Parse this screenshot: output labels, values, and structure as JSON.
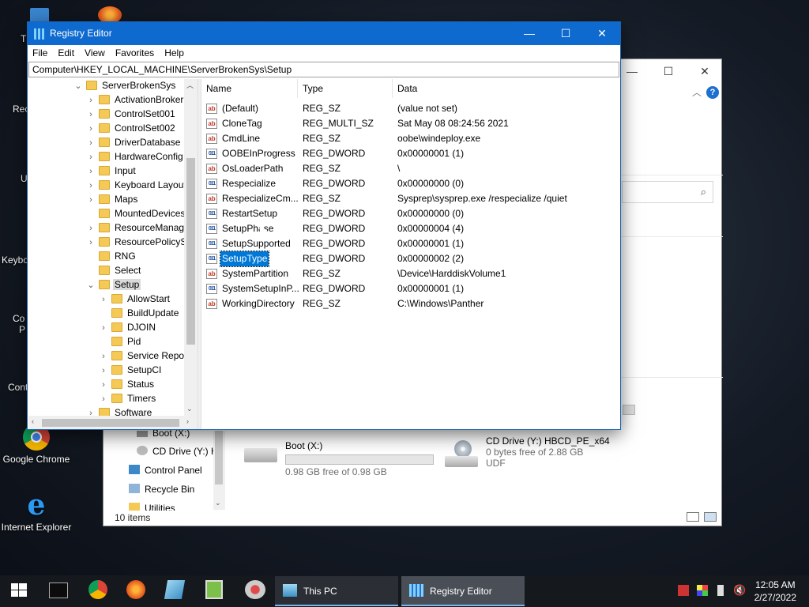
{
  "desktop": {
    "icons": [
      {
        "label": "Google Chrome"
      },
      {
        "label": "Internet Explorer"
      }
    ],
    "fragments": [
      "T",
      "Rec",
      "U",
      "Keybo",
      "Co",
      "P",
      "Cont"
    ]
  },
  "explorer": {
    "nav_items": [
      {
        "label": "Boot (X:)"
      },
      {
        "label": "CD Drive (Y:) H"
      },
      {
        "label": "Control Panel"
      },
      {
        "label": "Recycle Bin"
      },
      {
        "label": "Utilities"
      }
    ],
    "drives": [
      {
        "name": "Boot (X:)",
        "info": "0.98 GB free of 0.98 GB",
        "used_fraction": 0.0
      },
      {
        "name": "CD Drive (Y:) HBCD_PE_x64",
        "info": "0 bytes free of 2.88 GB",
        "fs": "UDF"
      }
    ],
    "status": "10 items",
    "help_glyph": "?"
  },
  "regedit": {
    "title": "Registry Editor",
    "menu": [
      "File",
      "Edit",
      "View",
      "Favorites",
      "Help"
    ],
    "address": "Computer\\HKEY_LOCAL_MACHINE\\ServerBrokenSys\\Setup",
    "tree": [
      {
        "label": "ServerBrokenSys",
        "chev": "⌄",
        "level": 0
      },
      {
        "label": "ActivationBroker",
        "chev": "›",
        "level": 1
      },
      {
        "label": "ControlSet001",
        "chev": "›",
        "level": 1
      },
      {
        "label": "ControlSet002",
        "chev": "›",
        "level": 1
      },
      {
        "label": "DriverDatabase",
        "chev": "›",
        "level": 1
      },
      {
        "label": "HardwareConfig",
        "chev": "›",
        "level": 1
      },
      {
        "label": "Input",
        "chev": "›",
        "level": 1
      },
      {
        "label": "Keyboard Layout",
        "chev": "›",
        "level": 1
      },
      {
        "label": "Maps",
        "chev": "›",
        "level": 1
      },
      {
        "label": "MountedDevices",
        "chev": "",
        "level": 1
      },
      {
        "label": "ResourceManager",
        "chev": "›",
        "level": 1
      },
      {
        "label": "ResourcePolicyStore",
        "chev": "›",
        "level": 1
      },
      {
        "label": "RNG",
        "chev": "",
        "level": 1
      },
      {
        "label": "Select",
        "chev": "",
        "level": 1
      },
      {
        "label": "Setup",
        "chev": "⌄",
        "level": 1,
        "selected": true
      },
      {
        "label": "AllowStart",
        "chev": "›",
        "level": 2
      },
      {
        "label": "BuildUpdate",
        "chev": "",
        "level": 2
      },
      {
        "label": "DJOIN",
        "chev": "›",
        "level": 2
      },
      {
        "label": "Pid",
        "chev": "",
        "level": 2
      },
      {
        "label": "Service Reporting",
        "chev": "›",
        "level": 2
      },
      {
        "label": "SetupCI",
        "chev": "›",
        "level": 2
      },
      {
        "label": "Status",
        "chev": "›",
        "level": 2
      },
      {
        "label": "Timers",
        "chev": "›",
        "level": 2
      },
      {
        "label": "Software",
        "chev": "›",
        "level": 1
      }
    ],
    "columns": {
      "name": "Name",
      "type": "Type",
      "data": "Data"
    },
    "values": [
      {
        "icon": "ab",
        "name": "(Default)",
        "type": "REG_SZ",
        "data": "(value not set)"
      },
      {
        "icon": "ab",
        "name": "CloneTag",
        "type": "REG_MULTI_SZ",
        "data": "Sat May 08 08:24:56 2021"
      },
      {
        "icon": "ab",
        "name": "CmdLine",
        "type": "REG_SZ",
        "data": "oobe\\windeploy.exe"
      },
      {
        "icon": "011",
        "name": "OOBEInProgress",
        "type": "REG_DWORD",
        "data": "0x00000001 (1)"
      },
      {
        "icon": "ab",
        "name": "OsLoaderPath",
        "type": "REG_SZ",
        "data": "\\"
      },
      {
        "icon": "011",
        "name": "Respecialize",
        "type": "REG_DWORD",
        "data": "0x00000000 (0)"
      },
      {
        "icon": "ab",
        "name": "RespecializeCm...",
        "type": "REG_SZ",
        "data": "Sysprep\\sysprep.exe /respecialize /quiet"
      },
      {
        "icon": "011",
        "name": "RestartSetup",
        "type": "REG_DWORD",
        "data": "0x00000000 (0)"
      },
      {
        "icon": "011",
        "name": "SetupPhase",
        "type": "REG_DWORD",
        "data": "0x00000004 (4)"
      },
      {
        "icon": "011",
        "name": "SetupSupported",
        "type": "REG_DWORD",
        "data": "0x00000001 (1)"
      },
      {
        "icon": "011",
        "name": "SetupType",
        "type": "REG_DWORD",
        "data": "0x00000002 (2)",
        "selected": true
      },
      {
        "icon": "ab",
        "name": "SystemPartition",
        "type": "REG_SZ",
        "data": "\\Device\\HarddiskVolume1"
      },
      {
        "icon": "011",
        "name": "SystemSetupInP...",
        "type": "REG_DWORD",
        "data": "0x00000001 (1)"
      },
      {
        "icon": "ab",
        "name": "WorkingDirectory",
        "type": "REG_SZ",
        "data": "C:\\Windows\\Panther"
      }
    ],
    "window_controls": {
      "minimize": "—",
      "maximize": "☐",
      "close": "✕"
    }
  },
  "taskbar": {
    "apps": [
      {
        "label": "This PC"
      },
      {
        "label": "Registry Editor",
        "active": true
      }
    ],
    "clock": {
      "time": "12:05 AM",
      "date": "2/27/2022"
    }
  },
  "colors": {
    "titlebar": "#0f6ad0",
    "selection": "#0078d7",
    "taskbar": "#15181d"
  }
}
